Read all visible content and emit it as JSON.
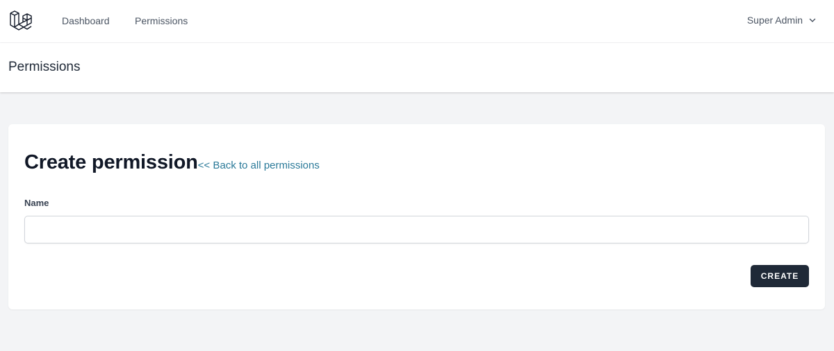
{
  "nav": {
    "logo_icon": "laravel-logo-icon",
    "links": [
      {
        "label": "Dashboard"
      },
      {
        "label": "Permissions"
      }
    ],
    "user": {
      "name": "Super Admin",
      "icon": "chevron-down-icon"
    }
  },
  "header": {
    "title": "Permissions"
  },
  "form": {
    "title": "Create permission",
    "back_link": "<< Back to all permissions",
    "name_label": "Name",
    "name_value": "",
    "submit_label": "CREATE"
  },
  "colors": {
    "link": "#2b7a99",
    "button_bg": "#1f2937",
    "page_bg": "#f3f4f6"
  }
}
